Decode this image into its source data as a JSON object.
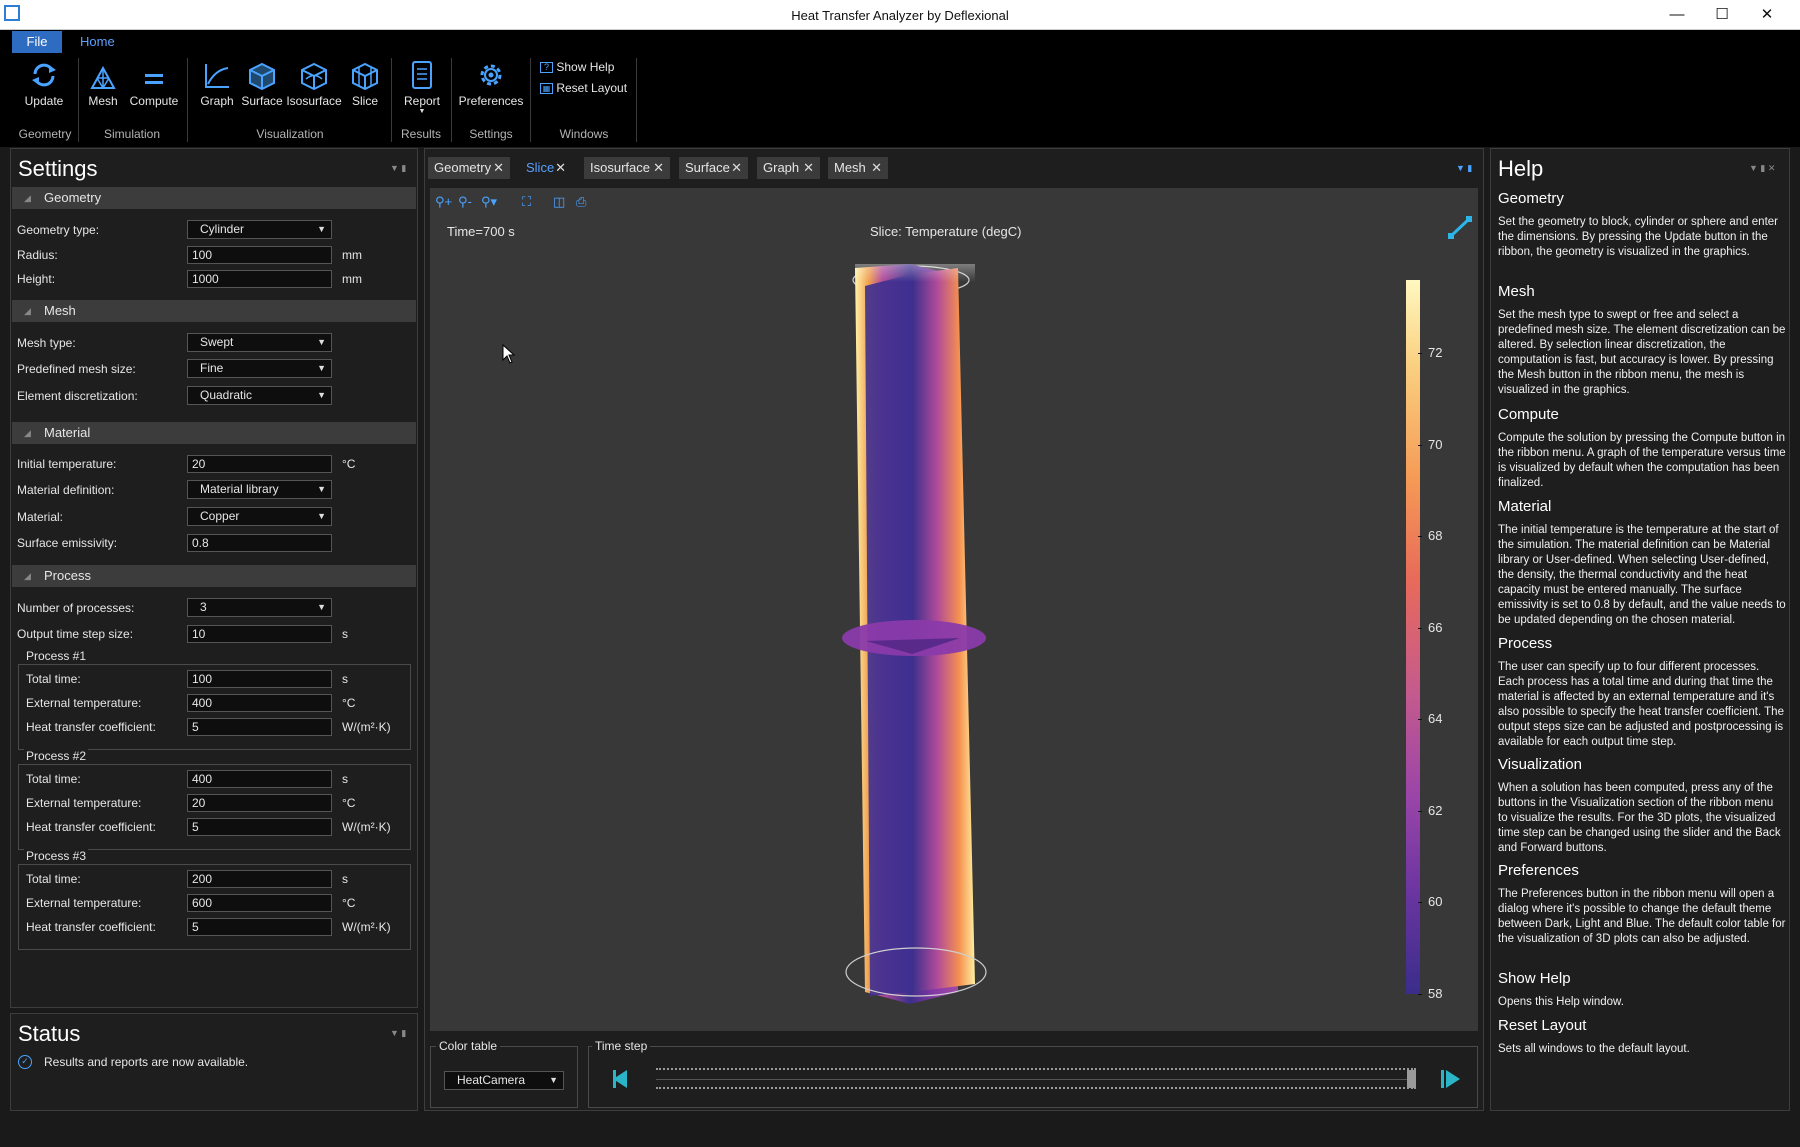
{
  "window": {
    "title": "Heat Transfer Analyzer by Deflexional"
  },
  "ribbon": {
    "tabs": {
      "file": "File",
      "home": "Home"
    },
    "update": "Update",
    "mesh": "Mesh",
    "compute": "Compute",
    "graph": "Graph",
    "surface": "Surface",
    "isosurface": "Isosurface",
    "slice": "Slice",
    "report": "Report",
    "preferences": "Preferences",
    "show_help": "Show Help",
    "reset_layout": "Reset Layout",
    "groups": {
      "geometry": "Geometry",
      "simulation": "Simulation",
      "visualization": "Visualization",
      "results": "Results",
      "settings": "Settings",
      "windows": "Windows"
    }
  },
  "settings": {
    "title": "Settings",
    "geometry": {
      "header": "Geometry",
      "geometry_type_label": "Geometry type:",
      "geometry_type": "Cylinder",
      "radius_label": "Radius:",
      "radius": "100",
      "radius_unit": "mm",
      "height_label": "Height:",
      "height": "1000",
      "height_unit": "mm"
    },
    "mesh": {
      "header": "Mesh",
      "mesh_type_label": "Mesh type:",
      "mesh_type": "Swept",
      "size_label": "Predefined mesh size:",
      "size": "Fine",
      "disc_label": "Element discretization:",
      "disc": "Quadratic"
    },
    "material": {
      "header": "Material",
      "init_temp_label": "Initial temperature:",
      "init_temp": "20",
      "init_temp_unit": "°C",
      "def_label": "Material definition:",
      "def": "Material library",
      "material_label": "Material:",
      "material": "Copper",
      "emiss_label": "Surface emissivity:",
      "emiss": "0.8"
    },
    "process": {
      "header": "Process",
      "num_label": "Number of processes:",
      "num": "3",
      "step_label": "Output time step size:",
      "step": "10",
      "step_unit": "s",
      "total_label": "Total time:",
      "ext_label": "External temperature:",
      "htc_label": "Heat transfer coefficient:",
      "unit_s": "s",
      "unit_c": "°C",
      "unit_htc": "W/(m²·K)",
      "processes": [
        {
          "title": "Process #1",
          "total": "100",
          "ext": "400",
          "htc": "5"
        },
        {
          "title": "Process #2",
          "total": "400",
          "ext": "20",
          "htc": "5"
        },
        {
          "title": "Process #3",
          "total": "200",
          "ext": "600",
          "htc": "5"
        }
      ]
    }
  },
  "status": {
    "title": "Status",
    "message": "Results and reports are now available."
  },
  "doc_tabs": [
    "Geometry",
    "Slice",
    "Isosurface",
    "Surface",
    "Graph",
    "Mesh"
  ],
  "active_tab": "Slice",
  "plot": {
    "time_label": "Time=700 s",
    "title": "Slice: Temperature (degC)",
    "colorbar_ticks": [
      "72",
      "70",
      "68",
      "66",
      "64",
      "62",
      "60",
      "58"
    ]
  },
  "color_table": {
    "label": "Color table",
    "value": "HeatCamera"
  },
  "time_step": {
    "label": "Time step",
    "position": 1.0
  },
  "help": {
    "title": "Help",
    "sections": [
      {
        "h": "Geometry",
        "p": "Set the geometry to block, cylinder or sphere and enter the dimensions. By pressing the Update button in the ribbon, the geometry is visualized in the graphics."
      },
      {
        "h": "Mesh",
        "p": "Set the mesh type to swept or free and select a predefined mesh size.  The element discretization can be altered. By selection linear discretization, the computation is fast, but accuracy is lower.  By pressing the Mesh button in the ribbon menu, the mesh is visualized in the graphics."
      },
      {
        "h": "Compute",
        "p": "Compute the solution by pressing the Compute button in the ribbon menu. A graph of the temperature versus time is visualized by default when the computation has been finalized."
      },
      {
        "h": "Material",
        "p": "The initial temperature is the temperature at the start of the simulation. The material definition can be Material library or User-defined. When selecting User-defined, the density, the thermal conductivity and the heat capacity must be entered manually. The surface emissivity is set to 0.8 by default, and the value needs to be updated depending on the chosen material."
      },
      {
        "h": "Process",
        "p": "The user can specify up to four different processes. Each process has a total time and during that time the material is affected by an external temperature and it's also possible to specify the heat transfer coefficient. The output steps size can be adjusted and postprocessing is available for each output time step."
      },
      {
        "h": "Visualization",
        "p": "When a solution has been computed, press any of the buttons in the Visualization section of the ribbon menu to visualize the results. For the 3D plots, the visualized time step can be changed using the slider and the Back and Forward buttons."
      },
      {
        "h": "Preferences",
        "p": "The Preferences button in the ribbon menu will open a dialog where it's possible to change the default theme between Dark, Light and Blue. The default color table for the visualization of 3D plots can also be adjusted."
      },
      {
        "h": "Show Help",
        "p": "Opens this Help window."
      },
      {
        "h": "Reset Layout",
        "p": "Sets all windows to the default layout."
      }
    ]
  }
}
